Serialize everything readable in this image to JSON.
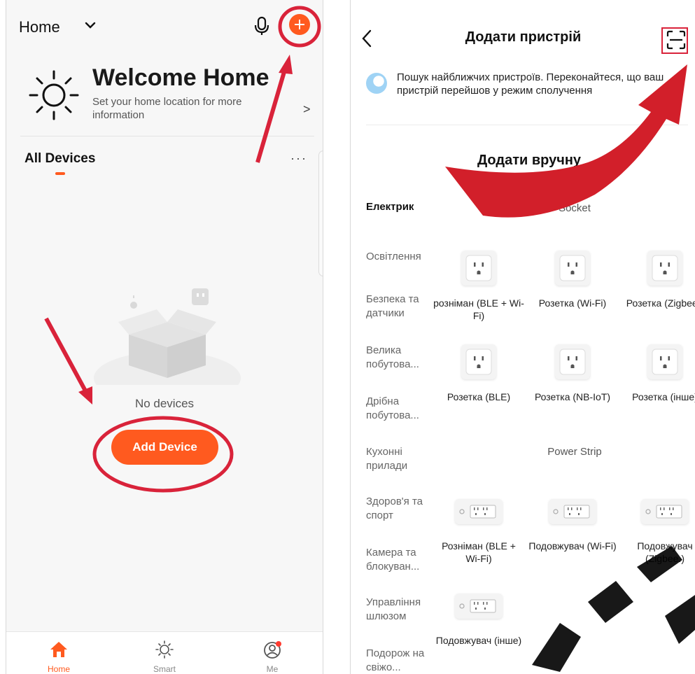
{
  "left": {
    "home_label": "Home",
    "welcome_title": "Welcome Home",
    "welcome_subtitle": "Set your home location for more information",
    "welcome_arrow": ">",
    "all_devices": "All Devices",
    "more": "···",
    "no_devices": "No devices",
    "add_device": "Add Device",
    "nav": [
      {
        "label": "Home",
        "icon": "home-icon"
      },
      {
        "label": "Smart",
        "icon": "sun-icon"
      },
      {
        "label": "Me",
        "icon": "profile-icon"
      }
    ],
    "accent_color": "#ff5a1f"
  },
  "right": {
    "title": "Додати пристрій",
    "search_text": "Пошук найближчих пристроїв. Переконайтеся, що ваш пристрій перейшов у режим сполучення",
    "manual_title": "Додати вручну",
    "categories": [
      "Електрик",
      "Освітлення",
      "Безпека та датчики",
      "Велика побутова...",
      "Дрібна побутова...",
      "Кухонні прилади",
      "Здоров'я та спорт",
      "Камера та блокуван...",
      "Управління шлюзом",
      "Подорож на свіжо..."
    ],
    "socket_section": "Socket",
    "power_strip_section": "Power Strip",
    "socket_devices": [
      "розніман (BLE + Wi-Fi)",
      "Розетка (Wi-Fi)",
      "Розетка (Zigbee.)",
      "Розетка (BLE)",
      "Розетка (NB-IoT)",
      "Розетка (інше)"
    ],
    "strip_devices": [
      "Розніман (BLE + Wi-Fi)",
      "Подовжувач (Wi-Fi)",
      "Подовжувач (Zigbee.)",
      "Подовжувач (інше)"
    ]
  }
}
